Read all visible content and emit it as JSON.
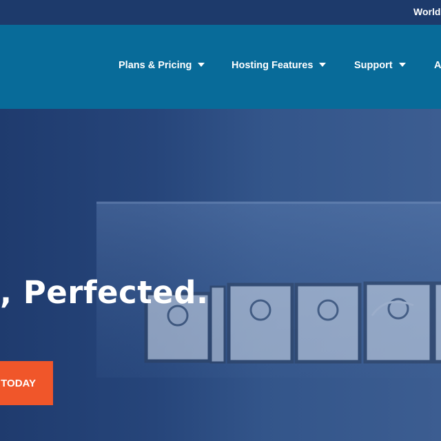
{
  "topbar": {
    "link_label": "World"
  },
  "nav": {
    "items": [
      {
        "label": "Plans & Pricing"
      },
      {
        "label": "Hosting Features"
      },
      {
        "label": "Support"
      },
      {
        "label": "A"
      }
    ]
  },
  "hero": {
    "headline": ", Perfected.",
    "cta_label": "TODAY"
  },
  "colors": {
    "topbar": "#1d3a6b",
    "navbar": "#086b99",
    "hero": "#2a4a80",
    "cta": "#f0562a"
  }
}
